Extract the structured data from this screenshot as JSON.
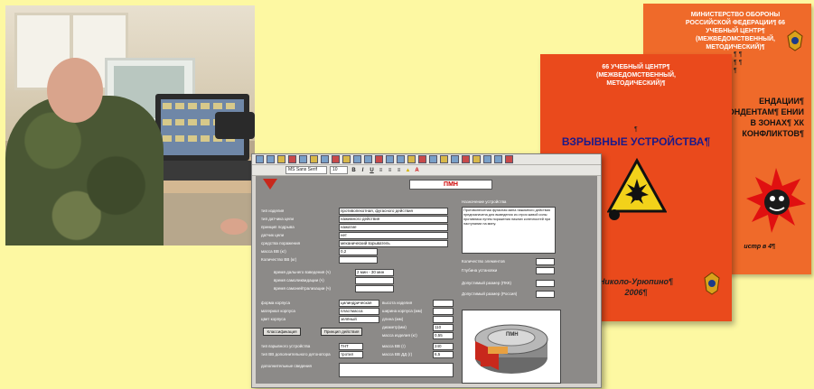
{
  "books": {
    "back": {
      "header": "МИНИСТЕРСТВО ОБОРОНЫ РОССИЙСКОЙ ФЕДЕРАЦИИ¶ 66 УЧЕБНЫЙ ЦЕНТР¶ (МЕЖВЕДОМСТВЕННЫЙ, МЕТОДИЧЕСКИЙ)¶",
      "pilcrows": "¶ ¶ ¶ ¶ ¶",
      "recommendations": "ЕНДАЦИИ¶ ОРРЕСПОНДЕНТАМ¶ ЕНИИ В ЗОНАХ¶ ХК КОНФЛИКТОВ¶",
      "number": "истр в 4¶"
    },
    "front": {
      "header": "66 УЧЕБНЫЙ ЦЕНТР¶ (МЕЖВЕДОМСТВЕННЫЙ, МЕТОДИЧЕСКИЙ)¶",
      "pilcrow": "¶",
      "title": "ВЗРЫВНЫЕ УСТРОЙСТВА¶",
      "place": "Николо-Урюпино¶",
      "year": "2006¶"
    }
  },
  "app": {
    "font_name": "MS Sans Serif",
    "font_size": "10",
    "form_title": "ПМН",
    "left_labels": [
      "тип изделия",
      "тип датчика цели",
      "принцип подрыва",
      "датчик цели",
      "средства поражения",
      "масса ВВ (кг)",
      "Количество ВВ (кг)"
    ],
    "left_values": [
      "противопехотная, фугасного действия",
      "нажимного действия",
      "нажатие",
      "нет",
      "механический взрыватель",
      "0,2",
      ""
    ],
    "mid_labels": [
      "время дальнего взведения (ч)",
      "время самоликвидации (ч)",
      "время самонейтрализации (ч)"
    ],
    "mid_values": [
      "2 мин - 30 мин",
      "",
      ""
    ],
    "low_labels": [
      "форма корпуса",
      "материал корпуса",
      "цвет корпуса"
    ],
    "low_values": [
      "цилиндрическая",
      "пластмасса",
      "зелёный"
    ],
    "dim_labels": [
      "высота изделия",
      "ширина корпуса (мм)",
      "длина (мм)",
      "диаметр(мм)",
      "масса изделия (кг)"
    ],
    "dim_values": [
      "",
      "",
      "",
      "110",
      "0,55"
    ],
    "buttons": [
      "Классификация",
      "Принцип действия"
    ],
    "bottom_labels": [
      "тип взрывного устройства",
      "тип ВВ дополнительного детонатора",
      "дополнительные сведения"
    ],
    "bottom_values": [
      "ТНТ",
      "тротил",
      ""
    ],
    "bottom_right_labels": [
      "масса ВВ (г)",
      "масса ВВ ДД (г)"
    ],
    "bottom_right_values": [
      "240",
      "6,5"
    ],
    "purpose_label": "Назначение устройства",
    "purpose_text": "Противопехотная фугасная мина нажимного действия предназначена для выведения из строя живой силы противника путем поражения нижних конечностей при наступании на мину.",
    "side_labels": [
      "Количество элементов",
      "Глубина установки",
      "Допустимый размер (ПКК)",
      "Допустимый размер (Россия)"
    ],
    "side_values": [
      "",
      "",
      "",
      ""
    ],
    "mine_label": "ПМН"
  },
  "colors": {
    "background": "#fdf8a2",
    "book_front": "#ea4a1c",
    "book_back": "#ef6a2a",
    "form_bg": "#8c8a88",
    "title_red": "#c00000"
  }
}
